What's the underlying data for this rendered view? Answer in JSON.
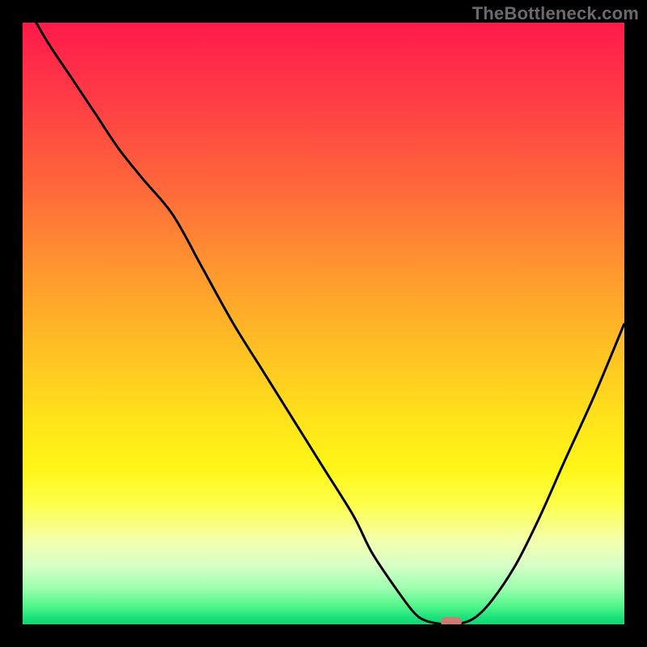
{
  "watermark": {
    "text": "TheBottleneck.com"
  },
  "colors": {
    "frame_bg": "#000000",
    "marker": "#cc7a72",
    "curve": "#000000"
  },
  "chart_data": {
    "type": "line",
    "title": "",
    "xlabel": "",
    "ylabel": "",
    "xlim": [
      0,
      100
    ],
    "ylim": [
      0,
      100
    ],
    "grid": false,
    "legend": false,
    "series": [
      {
        "name": "bottleneck-curve",
        "x": [
          0,
          4,
          8,
          12,
          16,
          20,
          25,
          30,
          35,
          40,
          45,
          50,
          55,
          58,
          62,
          65,
          67,
          70,
          72,
          75,
          78,
          82,
          86,
          90,
          95,
          100
        ],
        "y": [
          104,
          97,
          91,
          85,
          79,
          74,
          68,
          59,
          50,
          42,
          34,
          26,
          18,
          12,
          6,
          2,
          0.6,
          0,
          0,
          1,
          4,
          10,
          18,
          27,
          38,
          50
        ]
      }
    ],
    "marker": {
      "x": 71.2,
      "y": 0.4
    },
    "gradient_stops": [
      {
        "pos": 0.0,
        "color": "#ff1a4b"
      },
      {
        "pos": 0.12,
        "color": "#ff3a46"
      },
      {
        "pos": 0.28,
        "color": "#ff6a3a"
      },
      {
        "pos": 0.42,
        "color": "#ff9a2e"
      },
      {
        "pos": 0.55,
        "color": "#ffc223"
      },
      {
        "pos": 0.66,
        "color": "#ffe31a"
      },
      {
        "pos": 0.74,
        "color": "#fff617"
      },
      {
        "pos": 0.8,
        "color": "#fdff4a"
      },
      {
        "pos": 0.86,
        "color": "#f4ffad"
      },
      {
        "pos": 0.9,
        "color": "#d9ffc7"
      },
      {
        "pos": 0.94,
        "color": "#9dffb0"
      },
      {
        "pos": 0.97,
        "color": "#51f58a"
      },
      {
        "pos": 0.99,
        "color": "#17e07a"
      },
      {
        "pos": 1.0,
        "color": "#10d873"
      }
    ]
  }
}
